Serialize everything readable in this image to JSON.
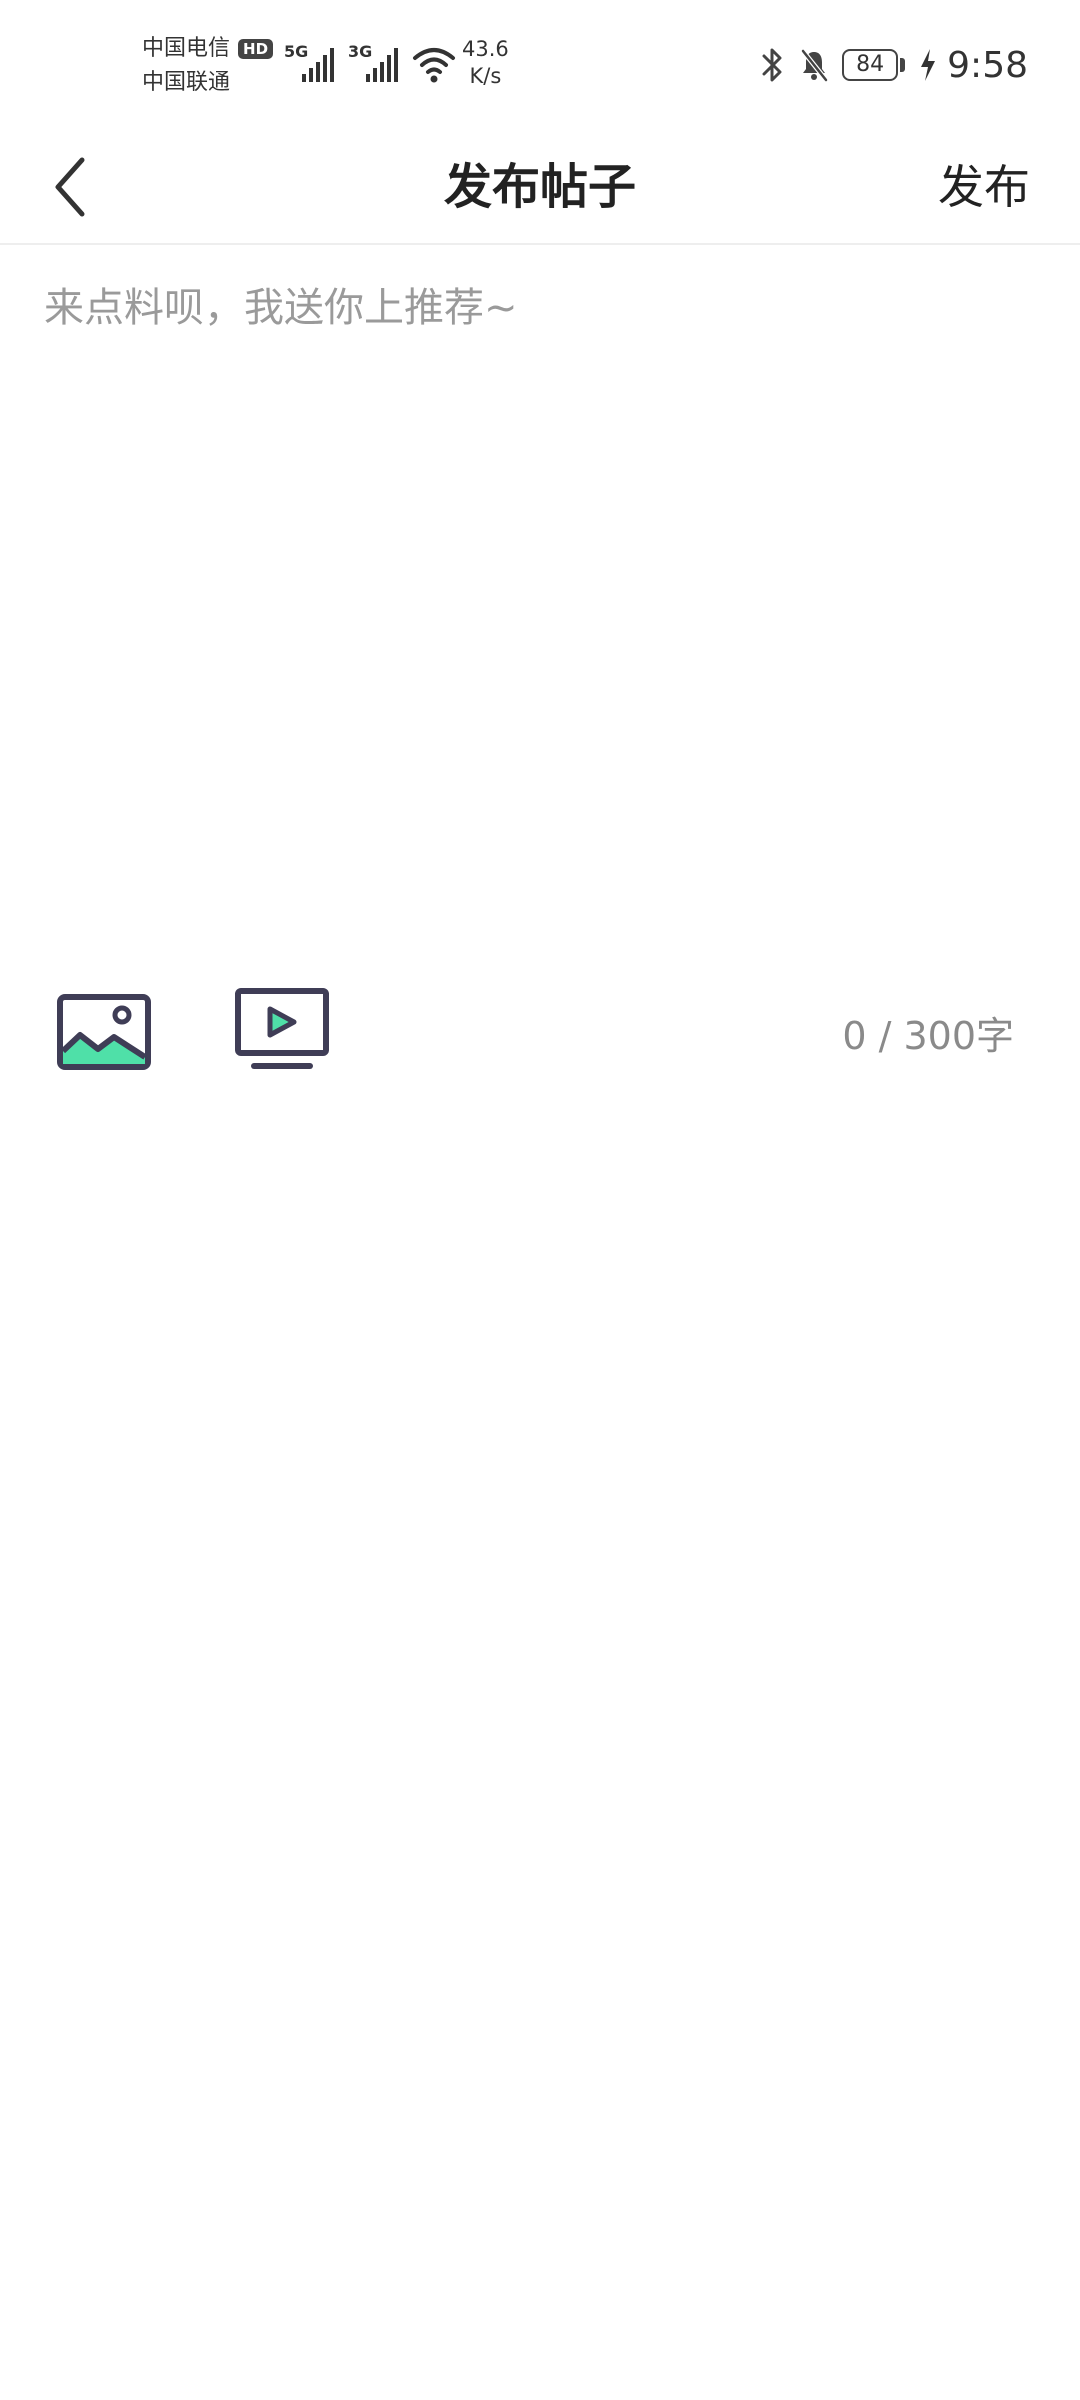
{
  "status_bar": {
    "carrier_1": "中国电信",
    "carrier_2": "中国联通",
    "hd_badge": "HD",
    "network_1": "5G",
    "network_2": "3G",
    "speed_value": "43.6",
    "speed_unit": "K/s",
    "battery_level": "84",
    "time": "9:58"
  },
  "nav": {
    "title": "发布帖子",
    "publish_label": "发布"
  },
  "editor": {
    "placeholder": "来点料呗，我送你上推荐~",
    "value": ""
  },
  "toolbar": {
    "image_icon": "image-icon",
    "video_icon": "video-icon",
    "counter": "0 / 300字"
  },
  "colors": {
    "accent_green": "#4fe0a8",
    "icon_dark": "#3f3d56",
    "placeholder_gray": "#9a9a9a"
  }
}
